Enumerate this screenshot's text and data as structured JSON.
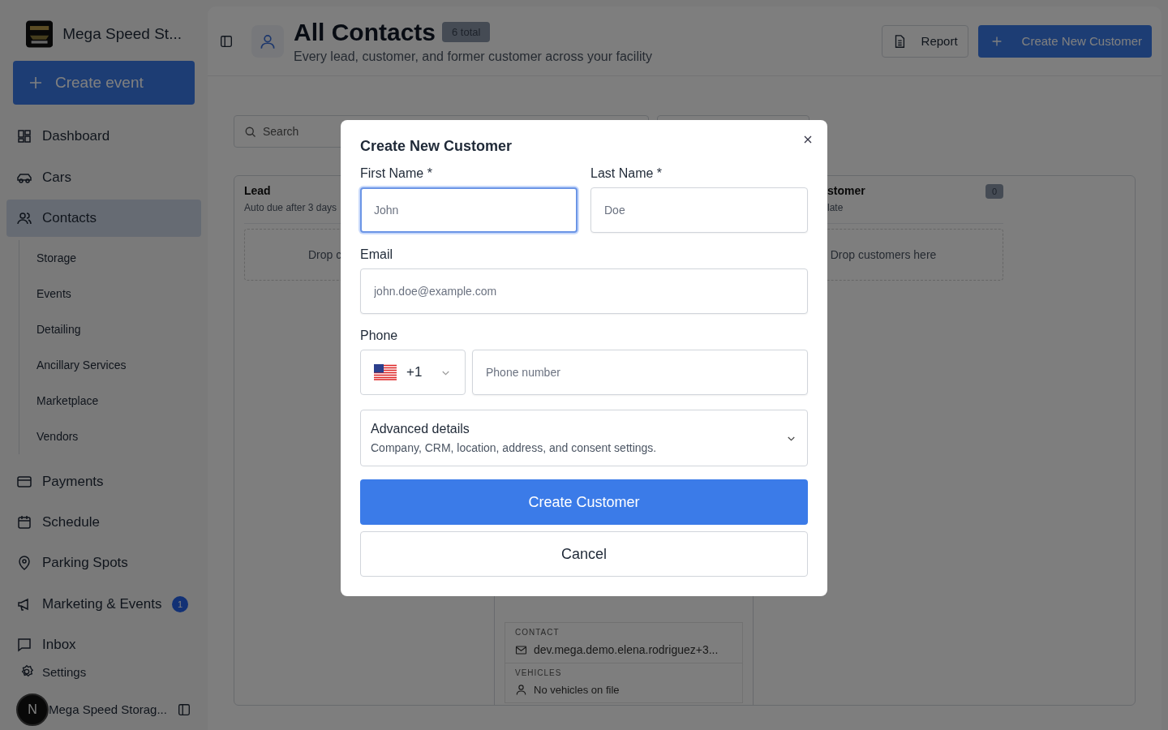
{
  "sidebar": {
    "brand": "Mega Speed St...",
    "create_button": "Create event",
    "items": [
      {
        "label": "Dashboard",
        "selected": false
      },
      {
        "label": "Cars",
        "selected": false
      },
      {
        "label": "Contacts",
        "selected": true,
        "children": [
          {
            "label": "Storage",
            "selected": false
          },
          {
            "label": "Events",
            "selected": false
          },
          {
            "label": "Detailing",
            "selected": false
          },
          {
            "label": "Ancillary Services",
            "selected": false
          },
          {
            "label": "Marketplace",
            "selected": false
          },
          {
            "label": "Vendors",
            "selected": false
          }
        ]
      },
      {
        "label": "Payments",
        "selected": false
      },
      {
        "label": "Schedule",
        "selected": false
      },
      {
        "label": "Parking Spots",
        "selected": false
      },
      {
        "label": "Marketing & Events",
        "selected": false,
        "badge": "1"
      },
      {
        "label": "Inbox",
        "selected": false
      }
    ],
    "settings": "Settings",
    "user": {
      "initial": "N",
      "name": "Mega Speed Storag..."
    }
  },
  "header": {
    "title": "All Contacts",
    "count_badge": "6 total",
    "subtitle": "Every lead, customer, and former customer across your facility",
    "buttons": [
      {
        "label": "Report",
        "kind": "secondary"
      },
      {
        "label": "Create New Customer",
        "kind": "primary"
      }
    ]
  },
  "search": {
    "placeholder": "Search"
  },
  "board": {
    "columns": [
      {
        "title": "Lead",
        "subtitle": "Auto due after 3 days",
        "drop_text": "Drop c"
      },
      {
        "card": {
          "sections": [
            {
              "heading": "CONTACT",
              "text": "dev.mega.demo.elena.rodriguez+3..."
            },
            {
              "heading": "VEHICLES",
              "text": "No vehicles on file"
            }
          ]
        }
      },
      {
        "title": "stomer",
        "subtitle": "late",
        "count": "0",
        "drop_text": "Drop customers here"
      }
    ]
  },
  "dialog": {
    "title": "Create New Customer",
    "name_fields": [
      {
        "label": "First Name *",
        "placeholder": "John",
        "focused": true
      },
      {
        "label": "Last Name *",
        "placeholder": "Doe",
        "focused": false
      }
    ],
    "email": {
      "label": "Email",
      "placeholder": "john.doe@example.com",
      "focused": false
    },
    "phone": {
      "label": "Phone",
      "country_code": "+1",
      "placeholder": "Phone number"
    },
    "advanced": {
      "title": "Advanced details",
      "description": "Company, CRM, location, address, and consent settings.",
      "expanded": false
    },
    "submit": "Create Customer",
    "cancel": "Cancel"
  }
}
